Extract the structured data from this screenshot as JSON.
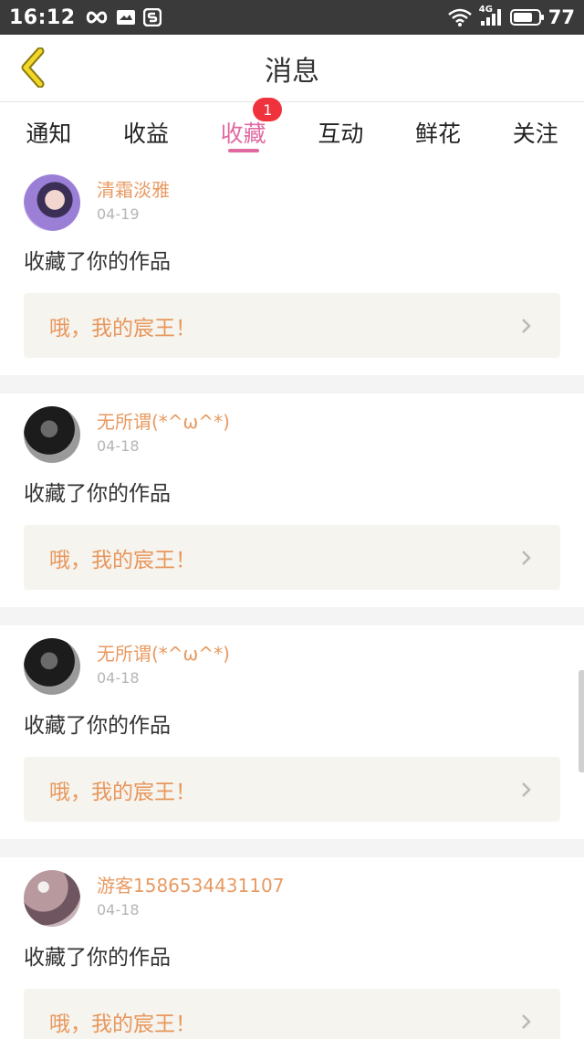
{
  "status_bar": {
    "time": "16:12",
    "network": "4G",
    "battery": "77",
    "battery_level": 0.77
  },
  "header": {
    "title": "消息"
  },
  "tabs": [
    {
      "label": "通知",
      "active": false
    },
    {
      "label": "收益",
      "active": false
    },
    {
      "label": "收藏",
      "active": true,
      "badge": "1"
    },
    {
      "label": "互动",
      "active": false
    },
    {
      "label": "鲜花",
      "active": false
    },
    {
      "label": "关注",
      "active": false
    }
  ],
  "messages": [
    {
      "username": "清霜淡雅",
      "date": "04-19",
      "action": "收藏了你的作品",
      "work_title": "哦，我的宸王！"
    },
    {
      "username": "无所谓(*^ω^*)",
      "date": "04-18",
      "action": "收藏了你的作品",
      "work_title": "哦，我的宸王！"
    },
    {
      "username": "无所谓(*^ω^*)",
      "date": "04-18",
      "action": "收藏了你的作品",
      "work_title": "哦，我的宸王！"
    },
    {
      "username": "游客1586534431107",
      "date": "04-18",
      "action": "收藏了你的作品",
      "work_title": "哦，我的宸王！"
    }
  ],
  "colors": {
    "accent": "#e06aa0",
    "username": "#e89a62",
    "badge": "#f0323c",
    "back_arrow": "#e8c51e"
  },
  "icons": [
    "back-arrow-icon",
    "infinity-icon",
    "mail-icon",
    "s-app-icon",
    "wifi-icon",
    "signal-icon",
    "battery-icon",
    "chevron-right-icon"
  ]
}
